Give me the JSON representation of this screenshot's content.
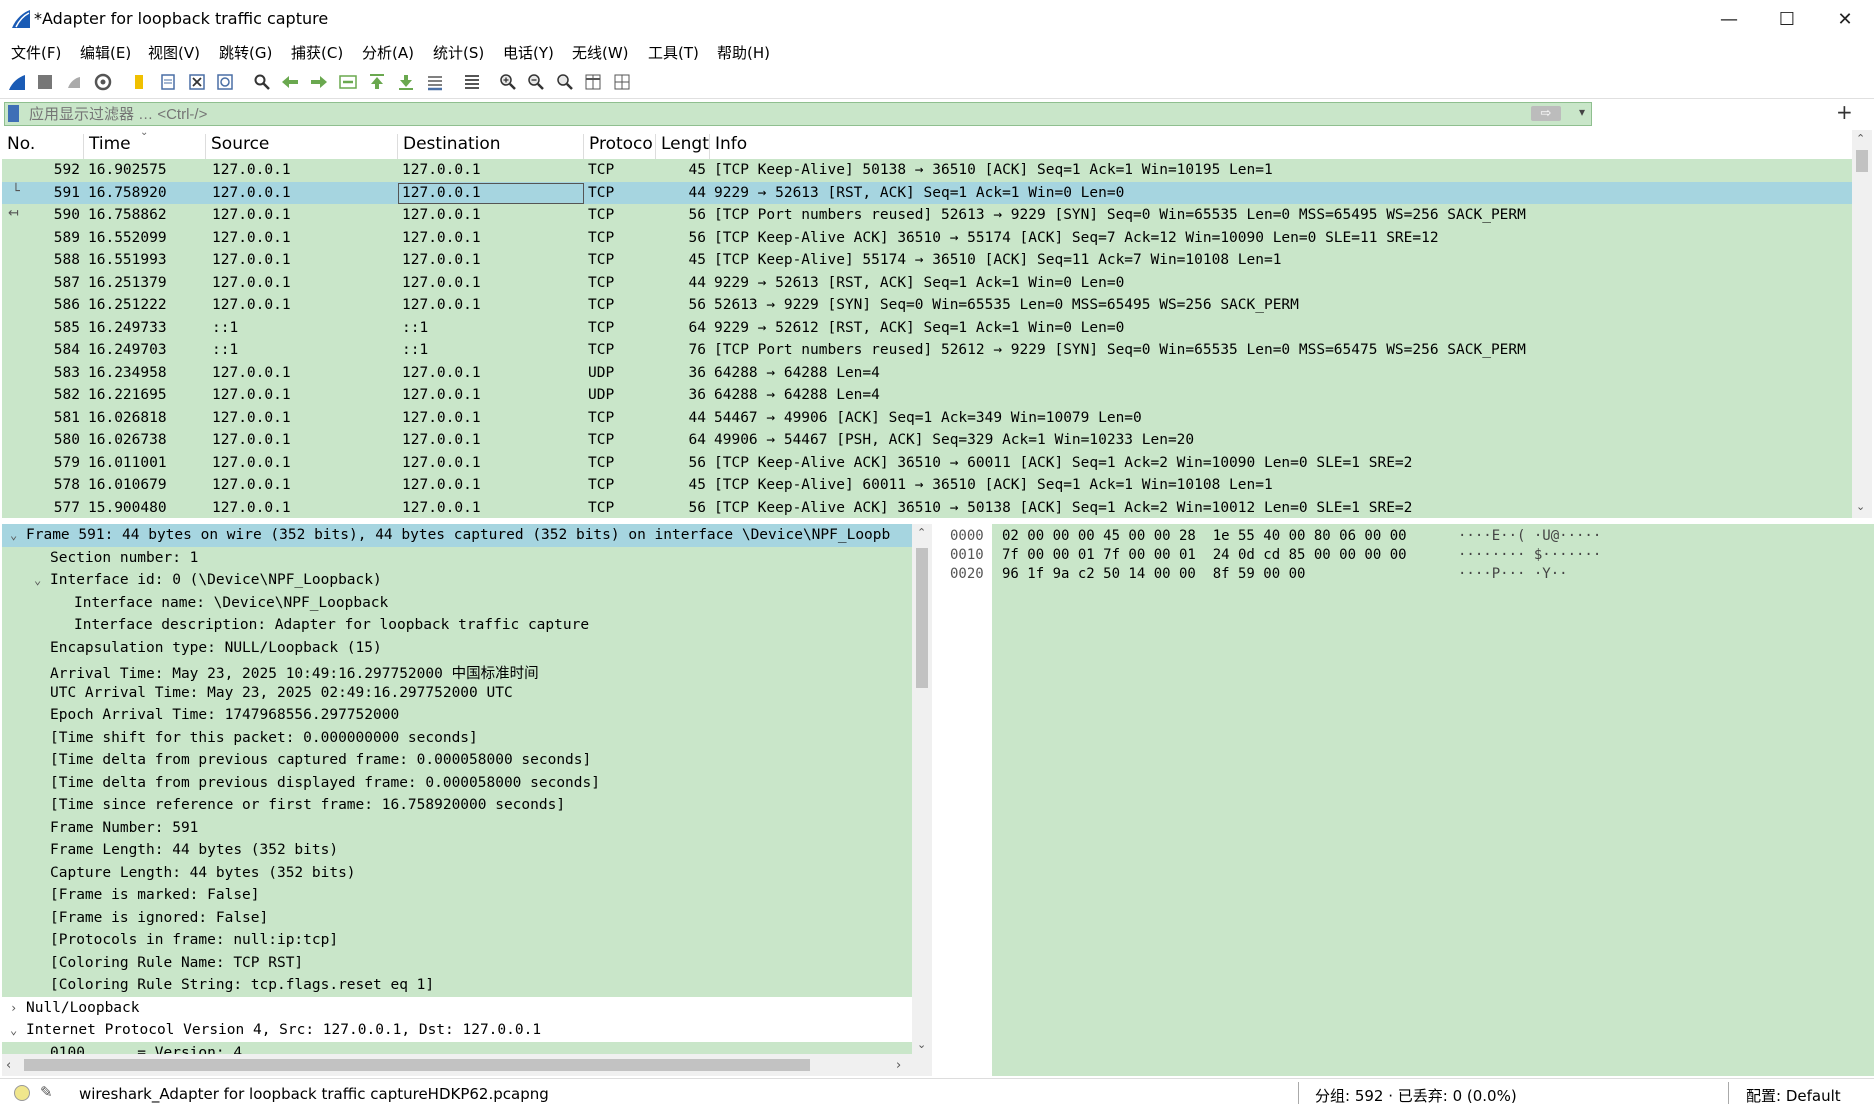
{
  "window": {
    "title": "*Adapter for loopback traffic capture",
    "min": "—",
    "max": "☐",
    "close": "✕"
  },
  "menu": [
    "文件(F)",
    "编辑(E)",
    "视图(V)",
    "跳转(G)",
    "捕获(C)",
    "分析(A)",
    "统计(S)",
    "电话(Y)",
    "无线(W)",
    "工具(T)",
    "帮助(H)"
  ],
  "toolbar_icons": [
    "shark-fin-start-icon",
    "stop-square-icon",
    "restart-capture-icon",
    "capture-options-gear-icon",
    "open-folder-icon",
    "save-file-icon",
    "close-file-icon",
    "reload-file-icon",
    "find-magnifier-icon",
    "go-back-arrow-icon",
    "go-forward-arrow-icon",
    "go-to-packet-icon",
    "go-first-packet-icon",
    "go-last-packet-icon",
    "autoscroll-icon",
    "colorize-list-icon",
    "zoom-in-icon",
    "zoom-out-icon",
    "zoom-normal-icon",
    "resize-columns-icon",
    "layout-grid-icon"
  ],
  "filter": {
    "placeholder": "应用显示过滤器 … <Ctrl-/>",
    "apply": "⇨",
    "dropdown": "▾",
    "add": "+"
  },
  "columns": [
    "No.",
    "Time",
    "Source",
    "Destination",
    "Protoco",
    "Lengt",
    "Info"
  ],
  "packets": [
    {
      "no": "592",
      "time": "16.902575",
      "src": "127.0.0.1",
      "dst": "127.0.0.1",
      "proto": "TCP",
      "len": "45",
      "info": "[TCP Keep-Alive] 50138 → 36510 [ACK] Seq=1 Ack=1 Win=10195 Len=1"
    },
    {
      "no": "591",
      "time": "16.758920",
      "src": "127.0.0.1",
      "dst": "127.0.0.1",
      "proto": "TCP",
      "len": "44",
      "info": "9229 → 52613 [RST, ACK] Seq=1 Ack=1 Win=0 Len=0"
    },
    {
      "no": "590",
      "time": "16.758862",
      "src": "127.0.0.1",
      "dst": "127.0.0.1",
      "proto": "TCP",
      "len": "56",
      "info": "[TCP Port numbers reused] 52613 → 9229 [SYN] Seq=0 Win=65535 Len=0 MSS=65495 WS=256 SACK_PERM"
    },
    {
      "no": "589",
      "time": "16.552099",
      "src": "127.0.0.1",
      "dst": "127.0.0.1",
      "proto": "TCP",
      "len": "56",
      "info": "[TCP Keep-Alive ACK] 36510 → 55174 [ACK] Seq=7 Ack=12 Win=10090 Len=0 SLE=11 SRE=12"
    },
    {
      "no": "588",
      "time": "16.551993",
      "src": "127.0.0.1",
      "dst": "127.0.0.1",
      "proto": "TCP",
      "len": "45",
      "info": "[TCP Keep-Alive] 55174 → 36510 [ACK] Seq=11 Ack=7 Win=10108 Len=1"
    },
    {
      "no": "587",
      "time": "16.251379",
      "src": "127.0.0.1",
      "dst": "127.0.0.1",
      "proto": "TCP",
      "len": "44",
      "info": "9229 → 52613 [RST, ACK] Seq=1 Ack=1 Win=0 Len=0"
    },
    {
      "no": "586",
      "time": "16.251222",
      "src": "127.0.0.1",
      "dst": "127.0.0.1",
      "proto": "TCP",
      "len": "56",
      "info": "52613 → 9229 [SYN] Seq=0 Win=65535 Len=0 MSS=65495 WS=256 SACK_PERM"
    },
    {
      "no": "585",
      "time": "16.249733",
      "src": "::1",
      "dst": "::1",
      "proto": "TCP",
      "len": "64",
      "info": "9229 → 52612 [RST, ACK] Seq=1 Ack=1 Win=0 Len=0"
    },
    {
      "no": "584",
      "time": "16.249703",
      "src": "::1",
      "dst": "::1",
      "proto": "TCP",
      "len": "76",
      "info": "[TCP Port numbers reused] 52612 → 9229 [SYN] Seq=0 Win=65535 Len=0 MSS=65475 WS=256 SACK_PERM"
    },
    {
      "no": "583",
      "time": "16.234958",
      "src": "127.0.0.1",
      "dst": "127.0.0.1",
      "proto": "UDP",
      "len": "36",
      "info": "64288 → 64288 Len=4"
    },
    {
      "no": "582",
      "time": "16.221695",
      "src": "127.0.0.1",
      "dst": "127.0.0.1",
      "proto": "UDP",
      "len": "36",
      "info": "64288 → 64288 Len=4"
    },
    {
      "no": "581",
      "time": "16.026818",
      "src": "127.0.0.1",
      "dst": "127.0.0.1",
      "proto": "TCP",
      "len": "44",
      "info": "54467 → 49906 [ACK] Seq=1 Ack=349 Win=10079 Len=0"
    },
    {
      "no": "580",
      "time": "16.026738",
      "src": "127.0.0.1",
      "dst": "127.0.0.1",
      "proto": "TCP",
      "len": "64",
      "info": "49906 → 54467 [PSH, ACK] Seq=329 Ack=1 Win=10233 Len=20"
    },
    {
      "no": "579",
      "time": "16.011001",
      "src": "127.0.0.1",
      "dst": "127.0.0.1",
      "proto": "TCP",
      "len": "56",
      "info": "[TCP Keep-Alive ACK] 36510 → 60011 [ACK] Seq=1 Ack=2 Win=10090 Len=0 SLE=1 SRE=2"
    },
    {
      "no": "578",
      "time": "16.010679",
      "src": "127.0.0.1",
      "dst": "127.0.0.1",
      "proto": "TCP",
      "len": "45",
      "info": "[TCP Keep-Alive] 60011 → 36510 [ACK] Seq=1 Ack=1 Win=10108 Len=1"
    },
    {
      "no": "577",
      "time": "15.900480",
      "src": "127.0.0.1",
      "dst": "127.0.0.1",
      "proto": "TCP",
      "len": "56",
      "info": "[TCP Keep-Alive ACK] 36510 → 50138 [ACK] Seq=1 Ack=2 Win=10012 Len=0 SLE=1 SRE=2"
    }
  ],
  "selected_index": 1,
  "details": [
    {
      "text": "Frame 591: 44 bytes on wire (352 bits), 44 bytes captured (352 bits) on interface \\Device\\NPF_Loopb",
      "indent": 0,
      "toggle": "⌄",
      "style": "hl"
    },
    {
      "text": "Section number: 1",
      "indent": 1,
      "toggle": "",
      "style": ""
    },
    {
      "text": "Interface id: 0 (\\Device\\NPF_Loopback)",
      "indent": 1,
      "toggle": "⌄",
      "style": ""
    },
    {
      "text": "Interface name: \\Device\\NPF_Loopback",
      "indent": 2,
      "toggle": "",
      "style": ""
    },
    {
      "text": "Interface description: Adapter for loopback traffic capture",
      "indent": 2,
      "toggle": "",
      "style": ""
    },
    {
      "text": "Encapsulation type: NULL/Loopback (15)",
      "indent": 1,
      "toggle": "",
      "style": ""
    },
    {
      "text": "Arrival Time: May 23, 2025 10:49:16.297752000 中国标准时间",
      "indent": 1,
      "toggle": "",
      "style": ""
    },
    {
      "text": "UTC Arrival Time: May 23, 2025 02:49:16.297752000 UTC",
      "indent": 1,
      "toggle": "",
      "style": ""
    },
    {
      "text": "Epoch Arrival Time: 1747968556.297752000",
      "indent": 1,
      "toggle": "",
      "style": ""
    },
    {
      "text": "[Time shift for this packet: 0.000000000 seconds]",
      "indent": 1,
      "toggle": "",
      "style": ""
    },
    {
      "text": "[Time delta from previous captured frame: 0.000058000 seconds]",
      "indent": 1,
      "toggle": "",
      "style": ""
    },
    {
      "text": "[Time delta from previous displayed frame: 0.000058000 seconds]",
      "indent": 1,
      "toggle": "",
      "style": ""
    },
    {
      "text": "[Time since reference or first frame: 16.758920000 seconds]",
      "indent": 1,
      "toggle": "",
      "style": ""
    },
    {
      "text": "Frame Number: 591",
      "indent": 1,
      "toggle": "",
      "style": ""
    },
    {
      "text": "Frame Length: 44 bytes (352 bits)",
      "indent": 1,
      "toggle": "",
      "style": ""
    },
    {
      "text": "Capture Length: 44 bytes (352 bits)",
      "indent": 1,
      "toggle": "",
      "style": ""
    },
    {
      "text": "[Frame is marked: False]",
      "indent": 1,
      "toggle": "",
      "style": ""
    },
    {
      "text": "[Frame is ignored: False]",
      "indent": 1,
      "toggle": "",
      "style": ""
    },
    {
      "text": "[Protocols in frame: null:ip:tcp]",
      "indent": 1,
      "toggle": "",
      "style": ""
    },
    {
      "text": "[Coloring Rule Name: TCP RST]",
      "indent": 1,
      "toggle": "",
      "style": ""
    },
    {
      "text": "[Coloring Rule String: tcp.flags.reset eq 1]",
      "indent": 1,
      "toggle": "",
      "style": ""
    },
    {
      "text": "Null/Loopback",
      "indent": 0,
      "toggle": "›",
      "style": "plain"
    },
    {
      "text": "Internet Protocol Version 4, Src: 127.0.0.1, Dst: 127.0.0.1",
      "indent": 0,
      "toggle": "⌄",
      "style": "plain"
    },
    {
      "text": "0100 .... = Version: 4",
      "indent": 1,
      "toggle": "",
      "style": ""
    }
  ],
  "bytes": [
    {
      "offset": "0000",
      "hex": "02 00 00 00 45 00 00 28  1e 55 40 00 80 06 00 00",
      "ascii": "····E··( ·U@·····"
    },
    {
      "offset": "0010",
      "hex": "7f 00 00 01 7f 00 00 01  24 0d cd 85 00 00 00 00",
      "ascii": "········ $·······"
    },
    {
      "offset": "0020",
      "hex": "96 1f 9a c2 50 14 00 00  8f 59 00 00",
      "ascii": "····P··· ·Y··"
    }
  ],
  "status": {
    "file": "wireshark_Adapter for loopback traffic captureHDKP62.pcapng",
    "packets": "分组: 592 · 已丢弃: 0 (0.0%)",
    "profile": "配置:  Default"
  },
  "colors": {
    "row_green": "#c9e6c9",
    "row_selected": "#a6d5e0"
  }
}
